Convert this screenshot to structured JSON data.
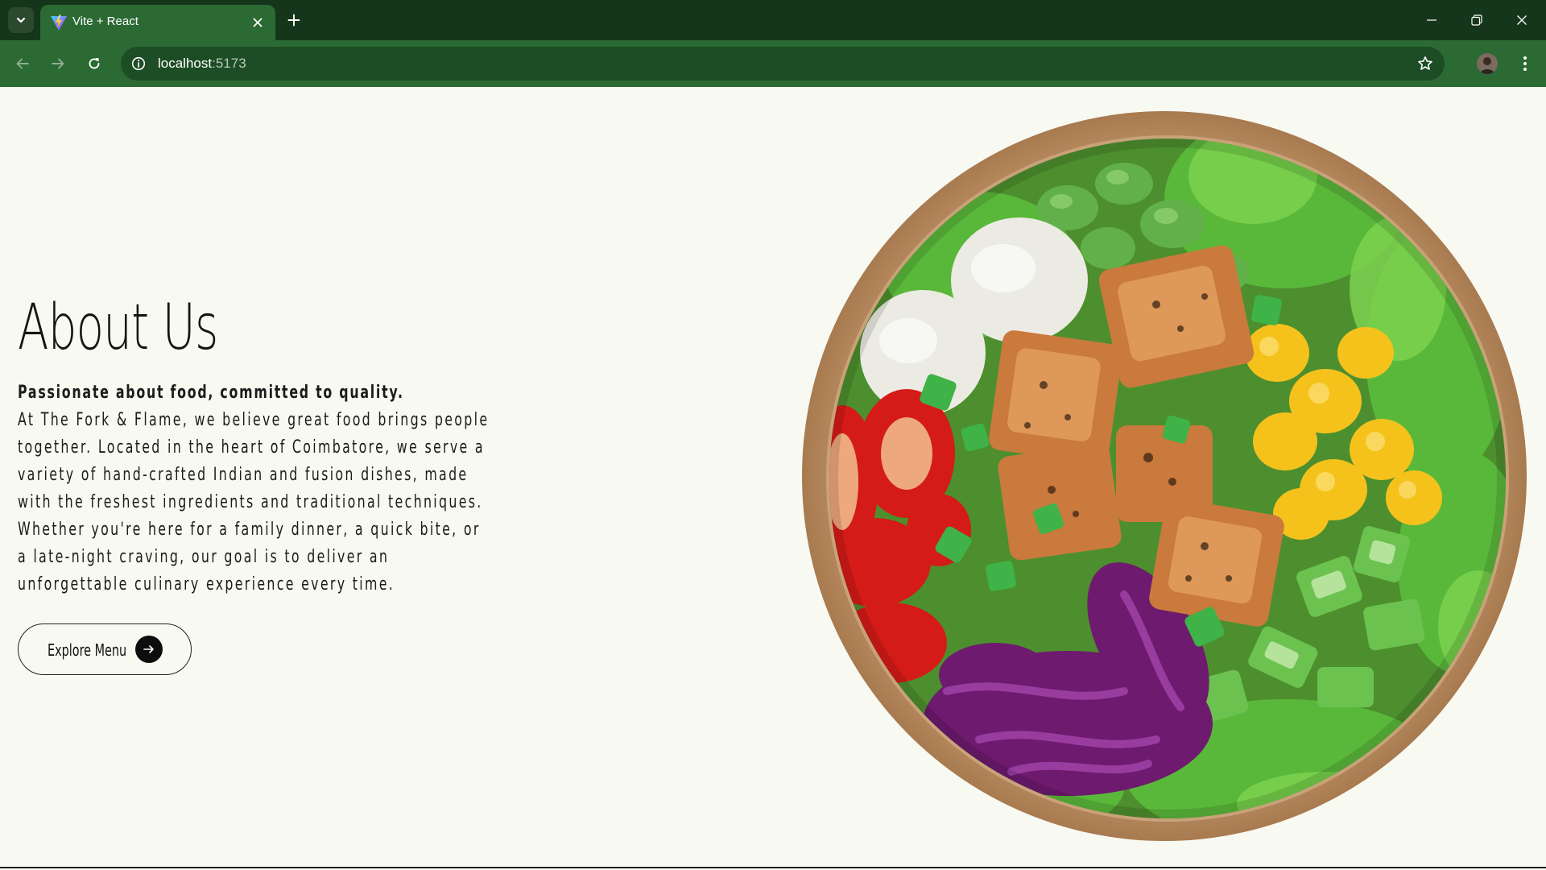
{
  "browser": {
    "tab": {
      "title": "Vite + React"
    },
    "address": {
      "host": "localhost",
      "port": ":5173"
    },
    "icons": {
      "tab_menu": "chevron-down-icon",
      "favicon": "vite-logo-icon",
      "tab_close": "close-icon",
      "new_tab": "plus-icon",
      "minimize": "minimize-icon",
      "restore": "restore-icon",
      "close": "close-icon",
      "back": "arrow-left-icon",
      "forward": "arrow-right-icon",
      "reload": "reload-icon",
      "site_info": "info-icon",
      "bookmark": "star-icon",
      "profile": "avatar",
      "menu": "kebab-menu-icon"
    },
    "colors": {
      "titlebar": "#15361a",
      "toolbar": "#2c6a34",
      "omnibox": "#1d4d24"
    }
  },
  "about": {
    "title": "About Us",
    "lead": "Passionate about food, committed to quality.",
    "paragraph1": "At The Fork & Flame, we believe great food brings people together. Located in the heart of Coimbatore, we serve a variety of hand-crafted Indian and fusion dishes, made with the freshest ingredients and traditional techniques.",
    "paragraph2": "Whether you're here for a family dinner, a quick bite, or a late-night craving, our goal is to deliver an unforgettable culinary experience every time.",
    "button_label": "Explore Menu",
    "button_icon": "arrow-right-icon"
  },
  "colors": {
    "page_background": "#f8f9f1",
    "text": "#141414"
  }
}
